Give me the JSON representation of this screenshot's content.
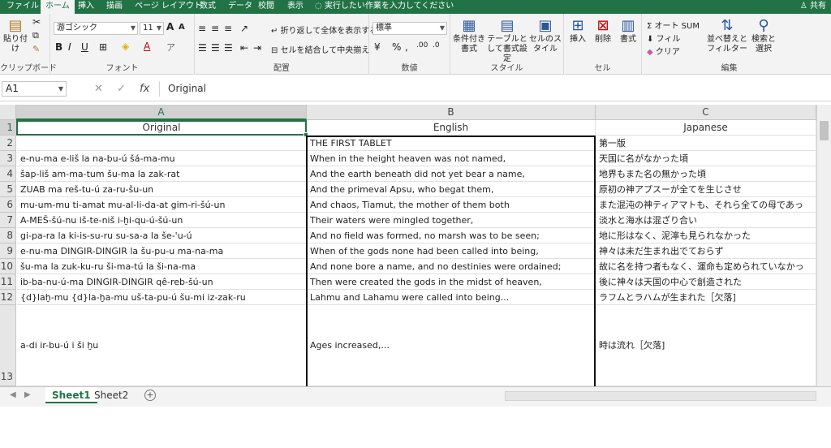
{
  "tabs": [
    "ファイル",
    "ホーム",
    "挿入",
    "描画",
    "ページ レイアウト",
    "数式",
    "データ",
    "校閲",
    "表示"
  ],
  "active_tab": "ホーム",
  "tell_me": "実行したい作業を入力してください",
  "share": "共有",
  "ribbon": {
    "clipboard": {
      "paste": "貼り付け",
      "label": "クリップボード"
    },
    "font": {
      "name": "游ゴシック",
      "size": "11",
      "label": "フォント"
    },
    "alignment": {
      "wrap": "折り返して全体を表示する",
      "merge": "セルを結合して中央揃え",
      "label": "配置"
    },
    "number": {
      "format": "標準",
      "label": "数値"
    },
    "styles": {
      "conditional": "条件付き書式",
      "table": "テーブルとして書式設定",
      "cell": "セルのスタイル",
      "label": "スタイル"
    },
    "cells": {
      "insert": "挿入",
      "delete": "削除",
      "format": "書式",
      "label": "セル"
    },
    "editing": {
      "autosum": "オート SUM",
      "fill": "フィル",
      "clear": "クリア",
      "sort": "並べ替えとフィルター",
      "find": "検索と選択",
      "label": "編集"
    }
  },
  "name_box": "A1",
  "formula": "Original",
  "columns": [
    "A",
    "B",
    "C"
  ],
  "rows": [
    {
      "n": "1",
      "a": "Original",
      "b": "English",
      "c": "Japanese"
    },
    {
      "n": "2",
      "a": "",
      "b": "THE FIRST TABLET",
      "c": "第一版"
    },
    {
      "n": "3",
      "a": "e-nu-ma e-liš la na-bu-ú šá-ma-mu",
      "b": "When in the height heaven was not named,",
      "c": "天国に名がなかった頃"
    },
    {
      "n": "4",
      "a": "šap-liš am-ma-tum šu-ma la zak-rat",
      "b": "And the earth beneath did not yet bear a name,",
      "c": "地界もまた名の無かった頃"
    },
    {
      "n": "5",
      "a": "ZUAB ma reš-tu-ú za-ru-šu-un",
      "b": "And the primeval Apsu, who begat them,",
      "c": "原初の神アプスーが全てを生じさせ"
    },
    {
      "n": "6",
      "a": "mu-um-mu ti-amat mu-al-li-da-at gim-ri-šú-un",
      "b": "And chaos, Tiamut, the mother of them both",
      "c": "また混沌の神ティアマトも、それら全ての母であっ"
    },
    {
      "n": "7",
      "a": "A-MEŠ-šú-nu iš-te-niš i-ḫi-qu-ú-šú-un",
      "b": "Their waters were mingled together,",
      "c": "淡水と海水は混ざり合い"
    },
    {
      "n": "8",
      "a": "gi-pa-ra la ki-is-su-ru su-sa-a la še-'u-ú",
      "b": "And no field was formed, no marsh was to be seen;",
      "c": "地に形はなく、泥濘も見られなかった"
    },
    {
      "n": "9",
      "a": "e-nu-ma DINGIR-DINGIR la šu-pu-u ma-na-ma",
      "b": "When of the gods none had been called into being,",
      "c": "神々は未だ生まれ出でておらず"
    },
    {
      "n": "10",
      "a": "šu-ma la zuk-ku-ru ši-ma-tú la ši-na-ma",
      "b": "And none bore a name, and no destinies were ordained;",
      "c": "故に名を持つ者もなく、運命も定められていなかっ"
    },
    {
      "n": "11",
      "a": "ib-ba-nu-ú-ma DINGIR-DINGIR qê-reb-šú-un",
      "b": "Then were created the gods in the midst of heaven,",
      "c": "後に神々は天国の中心で創造された"
    },
    {
      "n": "12",
      "a": "{d}laḫ-mu {d}la-ḫa-mu uš-ta-pu-ú šu-mi iz-zak-ru",
      "b": "Lahmu and Lahamu were called into being...",
      "c": "ラフムとラハムが生まれた［欠落]"
    },
    {
      "n": "13",
      "a": "a-di ir-bu-ú i ši ḫu",
      "b": "Ages increased,...",
      "c": "時は流れ［欠落]"
    }
  ],
  "sheets": [
    "Sheet1",
    "Sheet2"
  ],
  "active_sheet": "Sheet1"
}
